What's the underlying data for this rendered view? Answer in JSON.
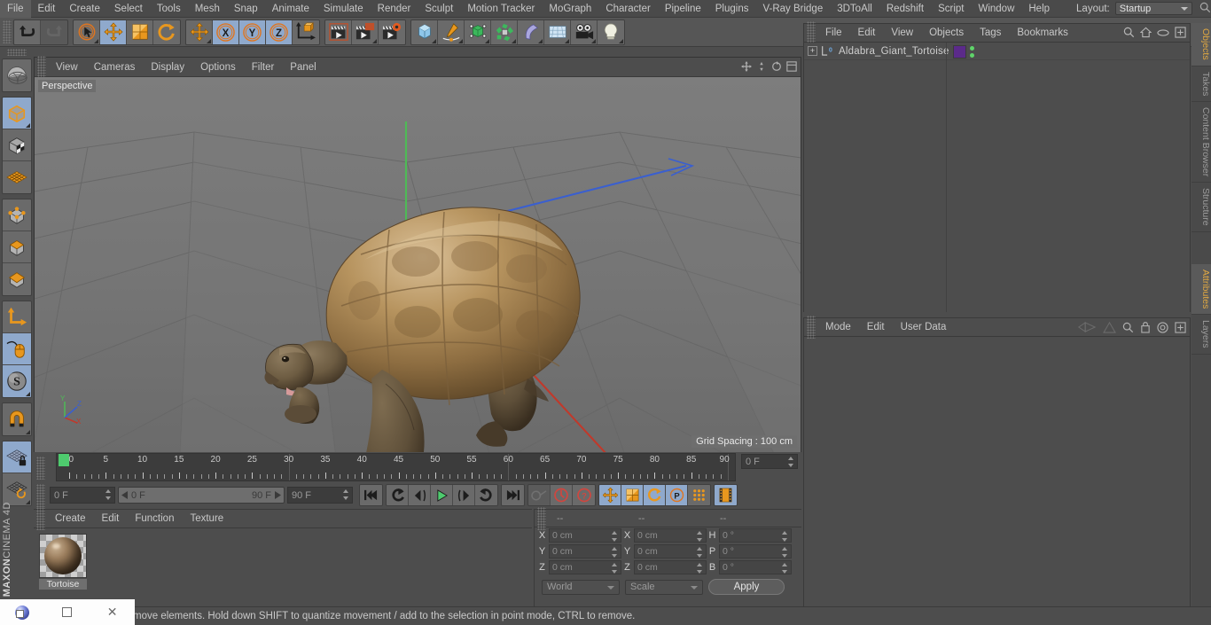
{
  "app": {
    "title": "CINEMA 4D",
    "brand_top": "MAXON",
    "brand_bottom": "CINEMA 4D"
  },
  "menubar": {
    "items": [
      {
        "label": "File"
      },
      {
        "label": "Edit"
      },
      {
        "label": "Create"
      },
      {
        "label": "Select"
      },
      {
        "label": "Tools"
      },
      {
        "label": "Mesh"
      },
      {
        "label": "Snap"
      },
      {
        "label": "Animate"
      },
      {
        "label": "Simulate"
      },
      {
        "label": "Render"
      },
      {
        "label": "Sculpt"
      },
      {
        "label": "Motion Tracker"
      },
      {
        "label": "MoGraph"
      },
      {
        "label": "Character"
      },
      {
        "label": "Pipeline"
      },
      {
        "label": "Plugins"
      },
      {
        "label": "V-Ray Bridge"
      },
      {
        "label": "3DToAll"
      },
      {
        "label": "Redshift"
      },
      {
        "label": "Script"
      },
      {
        "label": "Window"
      },
      {
        "label": "Help"
      }
    ],
    "layout_label": "Layout:",
    "layout_value": "Startup",
    "search_icon": "search-icon"
  },
  "toolbar": {
    "groups": [
      {
        "name": "history",
        "buttons": [
          {
            "name": "undo-button",
            "icon": "undo-arrow-icon",
            "active": false,
            "dim": false
          },
          {
            "name": "redo-button",
            "icon": "redo-arrow-icon",
            "active": false,
            "dim": true
          }
        ]
      },
      {
        "name": "transform-tools",
        "buttons": [
          {
            "name": "live-selection-tool",
            "icon": "cursor-circle-icon",
            "active": false,
            "dim": false,
            "corner": true
          },
          {
            "name": "move-tool",
            "icon": "move-arrows-icon",
            "active": true,
            "dim": false
          },
          {
            "name": "scale-tool",
            "icon": "scale-box-icon",
            "active": false,
            "dim": false
          },
          {
            "name": "rotate-tool",
            "icon": "rotate-arrow-icon",
            "active": false,
            "dim": false
          }
        ]
      },
      {
        "name": "axis-lock",
        "buttons": [
          {
            "name": "move-alt-tool",
            "icon": "move-arrows-icon",
            "active": false,
            "dim": false,
            "corner": true
          },
          {
            "name": "lock-x-axis",
            "icon": "x-axis-icon",
            "active": true,
            "dim": false
          },
          {
            "name": "lock-y-axis",
            "icon": "y-axis-icon",
            "active": true,
            "dim": false
          },
          {
            "name": "lock-z-axis",
            "icon": "z-axis-icon",
            "active": true,
            "dim": false
          },
          {
            "name": "world-object-axis",
            "icon": "world-axis-cube-icon",
            "active": false,
            "dim": false
          }
        ]
      },
      {
        "name": "render-tools",
        "buttons": [
          {
            "name": "render-view-button",
            "icon": "clapper-icon",
            "active": false,
            "dim": false
          },
          {
            "name": "render-region-button",
            "icon": "clapper-region-icon",
            "active": false,
            "dim": false,
            "corner": true
          },
          {
            "name": "render-settings-button",
            "icon": "clapper-gear-icon",
            "active": false,
            "dim": false
          }
        ]
      },
      {
        "name": "create-objects",
        "buttons": [
          {
            "name": "add-cube-button",
            "icon": "cube-icon",
            "active": false,
            "dim": false,
            "corner": true
          },
          {
            "name": "add-spline-button",
            "icon": "pen-spline-icon",
            "active": false,
            "dim": false,
            "corner": true
          },
          {
            "name": "add-generator-button",
            "icon": "nurbs-cube-icon",
            "active": false,
            "dim": false,
            "corner": true
          },
          {
            "name": "add-array-button",
            "icon": "array-icon",
            "active": false,
            "dim": false,
            "corner": true
          },
          {
            "name": "add-deformer-button",
            "icon": "bend-deformer-icon",
            "active": false,
            "dim": false,
            "corner": true
          },
          {
            "name": "add-environment-button",
            "icon": "floor-grid-icon",
            "active": false,
            "dim": false,
            "corner": true
          },
          {
            "name": "add-camera-button",
            "icon": "camera-icon",
            "active": false,
            "dim": false,
            "corner": true
          },
          {
            "name": "add-light-button",
            "icon": "light-bulb-icon",
            "active": false,
            "dim": false,
            "corner": true
          }
        ]
      }
    ]
  },
  "left_toolbar": {
    "groups": [
      {
        "name": "modes-top",
        "buttons": [
          {
            "name": "make-editable-button",
            "icon": "sphere-wireframe-icon",
            "active": false,
            "corner": false
          }
        ]
      },
      {
        "name": "object-modes",
        "buttons": [
          {
            "name": "model-mode-button",
            "icon": "model-cube-icon",
            "active": true,
            "corner": true
          },
          {
            "name": "texture-mode-button",
            "icon": "texture-cube-icon",
            "active": false,
            "corner": false
          },
          {
            "name": "workplane-button",
            "icon": "workplane-grid-icon",
            "active": false,
            "corner": false
          }
        ]
      },
      {
        "name": "component-modes",
        "buttons": [
          {
            "name": "point-mode-button",
            "icon": "points-cube-icon",
            "active": false,
            "corner": false
          },
          {
            "name": "edge-mode-button",
            "icon": "edge-cube-icon",
            "active": false,
            "corner": false
          },
          {
            "name": "polygon-mode-button",
            "icon": "polygon-cube-icon",
            "active": false,
            "corner": false
          }
        ]
      },
      {
        "name": "axis-tools",
        "buttons": [
          {
            "name": "enable-axis-button",
            "icon": "axis-corner-icon",
            "active": false,
            "corner": false
          },
          {
            "name": "viewport-solo-button",
            "icon": "mouse-icon",
            "active": true,
            "corner": false
          },
          {
            "name": "soft-selection-button",
            "icon": "s-sphere-icon",
            "active": true,
            "corner": true
          }
        ]
      },
      {
        "name": "snap-tools",
        "buttons": [
          {
            "name": "enable-snap-button",
            "icon": "magnet-icon",
            "active": false,
            "corner": true
          }
        ]
      },
      {
        "name": "workplane-tools",
        "buttons": [
          {
            "name": "lock-workplane-button",
            "icon": "grid-lock-icon",
            "active": true,
            "corner": false
          },
          {
            "name": "planar-workplane-button",
            "icon": "grid-rotate-icon",
            "active": false,
            "corner": true
          }
        ]
      }
    ]
  },
  "viewport": {
    "menu": [
      {
        "label": "View"
      },
      {
        "label": "Cameras"
      },
      {
        "label": "Display"
      },
      {
        "label": "Options"
      },
      {
        "label": "Filter"
      },
      {
        "label": "Panel"
      }
    ],
    "label": "Perspective",
    "grid_spacing": "Grid Spacing : 100 cm",
    "axis_labels": {
      "x": "X",
      "y": "Y",
      "z": "Z"
    },
    "icons": [
      "pan-icon",
      "zoom-icon",
      "rotate-icon",
      "maximize-icon"
    ],
    "colors": {
      "background": "#737373",
      "x_axis": "#c0392b",
      "y_axis": "#3fa34a",
      "z_axis": "#3a5fd0",
      "shell": "#a8855c",
      "body": "#7a6548"
    }
  },
  "timeline": {
    "ticks": [
      {
        "label": "0",
        "frame": 0
      },
      {
        "label": "5",
        "frame": 5
      },
      {
        "label": "10",
        "frame": 10
      },
      {
        "label": "15",
        "frame": 15
      },
      {
        "label": "20",
        "frame": 20
      },
      {
        "label": "25",
        "frame": 25
      },
      {
        "label": "30",
        "frame": 30
      },
      {
        "label": "35",
        "frame": 35
      },
      {
        "label": "40",
        "frame": 40
      },
      {
        "label": "45",
        "frame": 45
      },
      {
        "label": "50",
        "frame": 50
      },
      {
        "label": "55",
        "frame": 55
      },
      {
        "label": "60",
        "frame": 60
      },
      {
        "label": "65",
        "frame": 65
      },
      {
        "label": "70",
        "frame": 70
      },
      {
        "label": "75",
        "frame": 75
      },
      {
        "label": "80",
        "frame": 80
      },
      {
        "label": "85",
        "frame": 85
      },
      {
        "label": "90",
        "frame": 90
      }
    ],
    "range_min": 0,
    "range_max": 90,
    "playhead_frame": 0,
    "current_frame_field": "0 F",
    "playhead_color": "#4ecb6e"
  },
  "transport": {
    "current_frame": "0 F",
    "range_start": "0 F",
    "range_end": "90 F",
    "end_frame": "90 F",
    "buttons": [
      {
        "name": "go-to-start-button",
        "icon": "skip-start-icon",
        "active": false,
        "dim": false
      },
      {
        "name": "previous-key-button",
        "icon": "prev-key-icon",
        "active": false,
        "dim": false
      },
      {
        "name": "step-back-button",
        "icon": "step-back-icon",
        "active": false,
        "dim": false
      },
      {
        "name": "play-button",
        "icon": "play-icon",
        "active": false,
        "dim": false
      },
      {
        "name": "step-forward-button",
        "icon": "step-forward-icon",
        "active": false,
        "dim": false
      },
      {
        "name": "next-key-button",
        "icon": "next-key-icon",
        "active": false,
        "dim": false
      },
      {
        "name": "go-to-end-button",
        "icon": "skip-end-icon",
        "active": false,
        "dim": false
      },
      {
        "name": "record-key-button",
        "icon": "key-icon",
        "active": false,
        "dim": true
      },
      {
        "name": "autokeying-button",
        "icon": "record-circle-icon",
        "active": false,
        "dim": false
      },
      {
        "name": "keyframe-selection-button",
        "icon": "question-circle-icon",
        "active": false,
        "dim": false
      },
      {
        "name": "record-position-button",
        "icon": "move-arrows-icon",
        "active": true,
        "dim": false
      },
      {
        "name": "record-scale-button",
        "icon": "scale-box-icon",
        "active": true,
        "dim": false
      },
      {
        "name": "record-rotation-button",
        "icon": "rotate-arrow-icon",
        "active": true,
        "dim": false
      },
      {
        "name": "record-parameter-button",
        "icon": "p-circle-icon",
        "active": true,
        "dim": false
      },
      {
        "name": "record-pla-button",
        "icon": "dots-grid-icon",
        "active": false,
        "dim": false
      },
      {
        "name": "timeline-button",
        "icon": "film-strip-icon",
        "active": true,
        "dim": false
      }
    ]
  },
  "material_manager": {
    "menu": [
      {
        "label": "Create"
      },
      {
        "label": "Edit"
      },
      {
        "label": "Function"
      },
      {
        "label": "Texture"
      }
    ],
    "materials": [
      {
        "name": "Tortoise"
      }
    ]
  },
  "coordinates": {
    "headers": [
      "--",
      "--",
      "--"
    ],
    "rows": [
      {
        "pos_label": "X",
        "pos_value": "0 cm",
        "size_label": "X",
        "size_value": "0 cm",
        "rot_label": "H",
        "rot_value": "0 °"
      },
      {
        "pos_label": "Y",
        "pos_value": "0 cm",
        "size_label": "Y",
        "size_value": "0 cm",
        "rot_label": "P",
        "rot_value": "0 °"
      },
      {
        "pos_label": "Z",
        "pos_value": "0 cm",
        "size_label": "Z",
        "size_value": "0 cm",
        "rot_label": "B",
        "rot_value": "0 °"
      }
    ],
    "system_dropdown": "World",
    "mode_dropdown": "Scale",
    "apply_label": "Apply"
  },
  "object_manager": {
    "menu": [
      {
        "label": "File"
      },
      {
        "label": "Edit"
      },
      {
        "label": "View"
      },
      {
        "label": "Objects"
      },
      {
        "label": "Tags"
      },
      {
        "label": "Bookmarks"
      }
    ],
    "icons": [
      "search-icon",
      "home-icon",
      "eye-icon",
      "plus-box-icon"
    ],
    "objects": [
      {
        "name": "Aldabra_Giant_Tortoise",
        "tag_color": "#5b2a8a",
        "visible_dots": 2
      }
    ]
  },
  "attributes_manager": {
    "menu": [
      {
        "label": "Mode"
      },
      {
        "label": "Edit"
      },
      {
        "label": "User Data"
      }
    ],
    "icons": [
      "nav-back-icon",
      "nav-up-icon",
      "search-icon",
      "lock-icon",
      "target-icon",
      "plus-box-icon"
    ]
  },
  "right_tabs": {
    "upper": [
      {
        "label": "Objects",
        "active": true
      },
      {
        "label": "Takes",
        "active": false
      },
      {
        "label": "Content Browser",
        "active": false
      },
      {
        "label": "Structure",
        "active": false
      }
    ],
    "lower": [
      {
        "label": "Attributes",
        "active": true
      },
      {
        "label": "Layers",
        "active": false
      }
    ]
  },
  "statusbar": {
    "message": "move elements. Hold down SHIFT to quantize movement / add to the selection in point mode, CTRL to remove."
  },
  "taskbar": {
    "items": [
      {
        "name": "start-orb",
        "label": ""
      },
      {
        "name": "restore-button",
        "label": ""
      },
      {
        "name": "close-button",
        "label": "✕"
      }
    ]
  }
}
